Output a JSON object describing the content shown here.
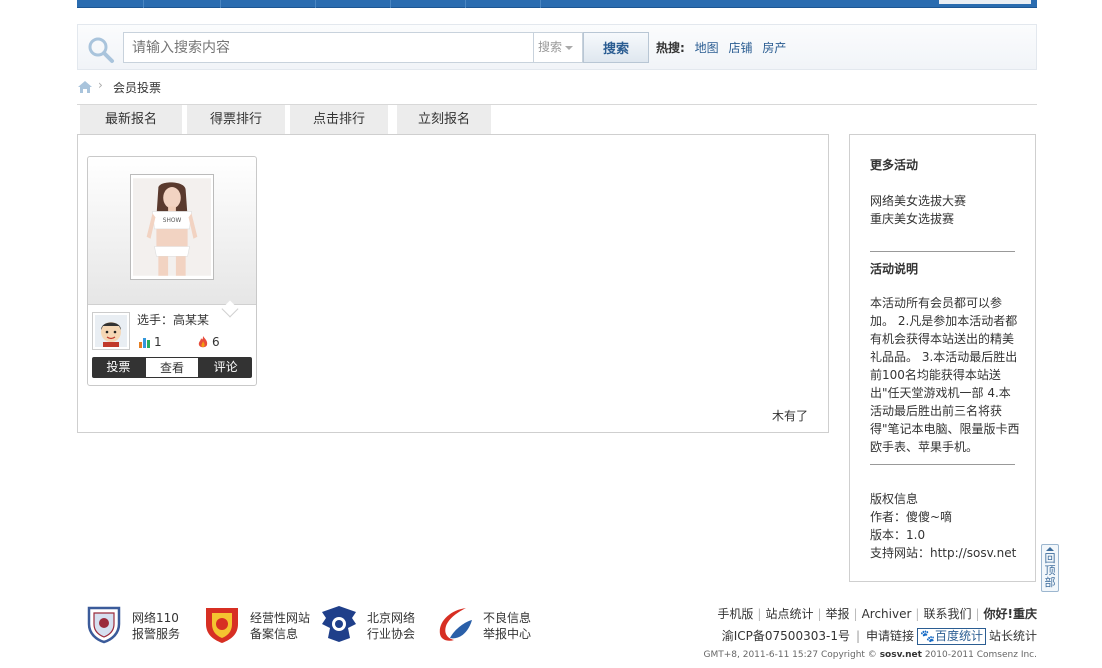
{
  "search": {
    "placeholder": "请输入搜索内容",
    "type_label": "搜索",
    "button_label": "搜索",
    "hot_label": "热搜:",
    "hot_links": [
      "地图",
      "店铺",
      "房产"
    ]
  },
  "breadcrumb": {
    "current": "会员投票"
  },
  "tabs": [
    "最新报名",
    "得票排行",
    "点击排行",
    "立刻报名"
  ],
  "card": {
    "player_label": "选手：高某某",
    "votes": "1",
    "hits": "6",
    "actions": [
      "投票",
      "查看",
      "评论"
    ],
    "photo_brand": "SHOW"
  },
  "main": {
    "no_more": "木有了"
  },
  "sidebar": {
    "more_title": "更多活动",
    "more_items": [
      "网络美女选拔大赛",
      "重庆美女选拔赛"
    ],
    "desc_title": "活动说明",
    "desc_text": "本活动所有会员都可以参加。 2.凡是参加本活动者都有机会获得本站送出的精美礼品品。 3.本活动最后胜出前100名均能获得本站送出\"任天堂游戏机一部 4.本活动最后胜出前三名将获得\"笔记本电脑、限量版卡西欧手表、苹果手机。",
    "copyright_title": "版权信息",
    "author": "作者：傻傻~嘀",
    "version": "版本：1.0",
    "support": "支持网站：http://sosv.net"
  },
  "totop": {
    "label": "回顶部"
  },
  "badges": [
    {
      "line1": "网络110",
      "line2": "报警服务"
    },
    {
      "line1": "经营性网站",
      "line2": "备案信息"
    },
    {
      "line1": "北京网络",
      "line2": "行业协会"
    },
    {
      "line1": "不良信息",
      "line2": "举报中心"
    }
  ],
  "footer": {
    "links": [
      "手机版",
      "站点统计",
      "举报",
      "Archiver",
      "联系我们"
    ],
    "site_name": "你好!重庆",
    "icp": "渝ICP备07500303-1号",
    "apply_link": "申请链接",
    "baidu": "百度统计",
    "admin_stats": "站长统计",
    "copyright_prefix": "GMT+8, 2011-6-11 15:27 Copyright ©",
    "copyright_site": "sosv.net",
    "copyright_suffix": "2010-2011 Comsenz Inc."
  },
  "colors": {
    "brand_blue": "#2a6cb0",
    "link_blue": "#2b5d92",
    "tab_bg": "#ececec"
  }
}
